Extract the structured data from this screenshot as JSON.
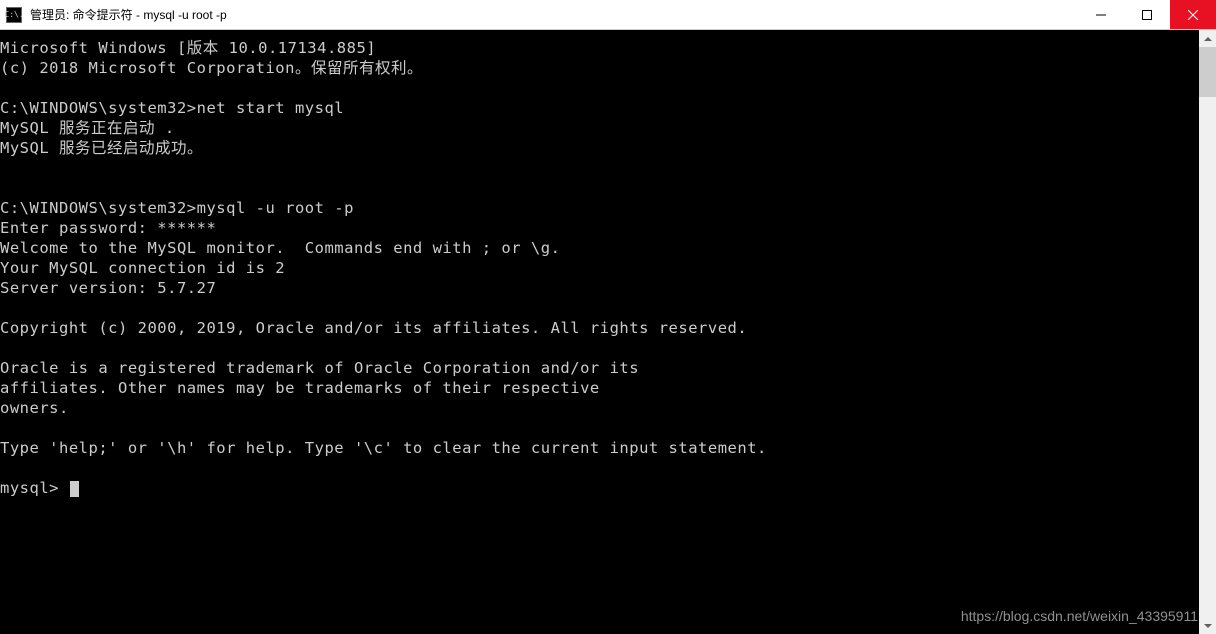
{
  "titlebar": {
    "icon_text": "C:\\.",
    "title": "管理员: 命令提示符 - mysql  -u root -p"
  },
  "terminal": {
    "line1": "Microsoft Windows [版本 10.0.17134.885]",
    "line2": "(c) 2018 Microsoft Corporation。保留所有权利。",
    "line3": "",
    "line4": "C:\\WINDOWS\\system32>net start mysql",
    "line5": "MySQL 服务正在启动 .",
    "line6": "MySQL 服务已经启动成功。",
    "line7": "",
    "line8": "",
    "line9": "C:\\WINDOWS\\system32>mysql -u root -p",
    "line10": "Enter password: ******",
    "line11": "Welcome to the MySQL monitor.  Commands end with ; or \\g.",
    "line12": "Your MySQL connection id is 2",
    "line13": "Server version: 5.7.27",
    "line14": "",
    "line15": "Copyright (c) 2000, 2019, Oracle and/or its affiliates. All rights reserved.",
    "line16": "",
    "line17": "Oracle is a registered trademark of Oracle Corporation and/or its",
    "line18": "affiliates. Other names may be trademarks of their respective",
    "line19": "owners.",
    "line20": "",
    "line21": "Type 'help;' or '\\h' for help. Type '\\c' to clear the current input statement.",
    "line22": "",
    "line23": "mysql> "
  },
  "watermark": "https://blog.csdn.net/weixin_43395911"
}
